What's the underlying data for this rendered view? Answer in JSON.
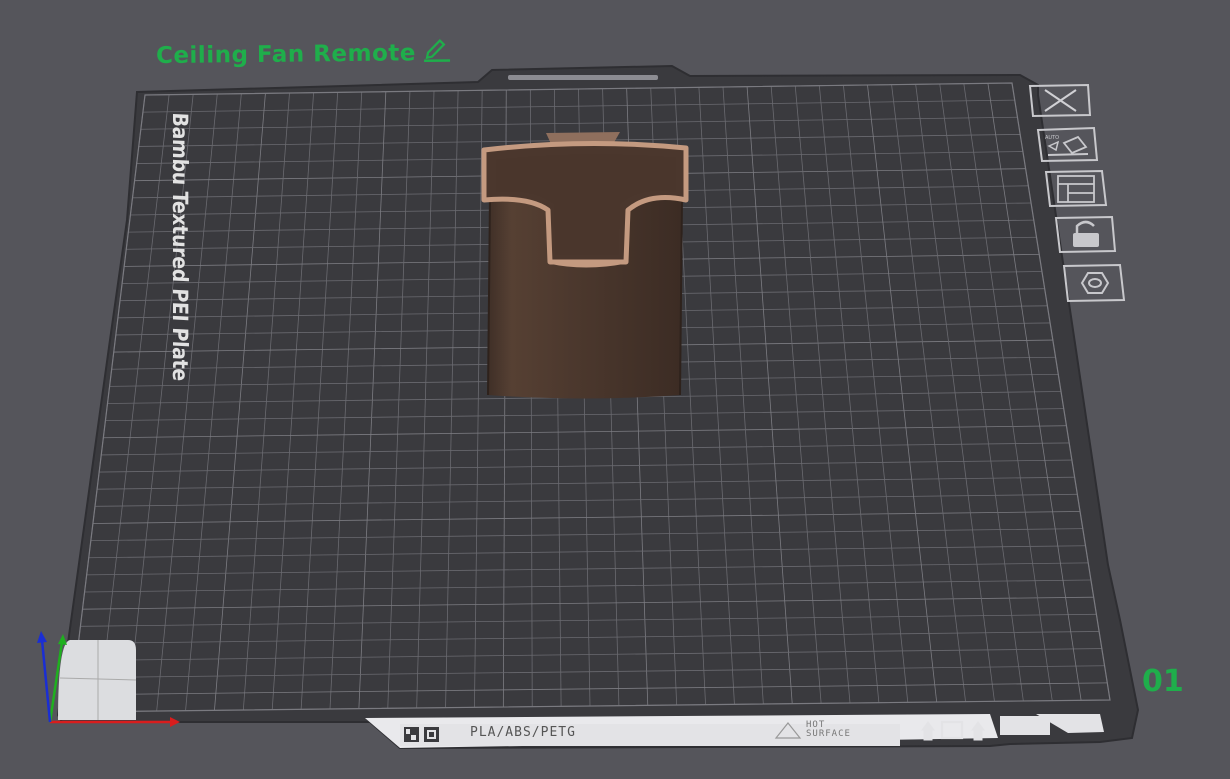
{
  "plate": {
    "title": "Ceiling Fan Remote",
    "number": "01",
    "name": "Bambu Textured PEI Plate",
    "material_compat": "PLA/ABS/PETG",
    "hot_surface": [
      "HOT",
      "SURFACE"
    ]
  },
  "icons": {
    "edit": "pencil-edit-icon",
    "close": "close-icon",
    "auto_orient": "auto-orient-icon",
    "arrange": "arrange-icon",
    "lock": "lock-icon",
    "settings": "hex-nut-settings-icon",
    "warning": "warning-triangle-icon"
  },
  "colors": {
    "background": "#55555b",
    "plate": "#3a3a3e",
    "grid": "#6a6a70",
    "accent": "#1fae4b",
    "model": "#4a362c",
    "model_edge": "#c49a80",
    "axis_x": "#d81d1d",
    "axis_y": "#1fb01f",
    "axis_z": "#1a2ed4"
  }
}
